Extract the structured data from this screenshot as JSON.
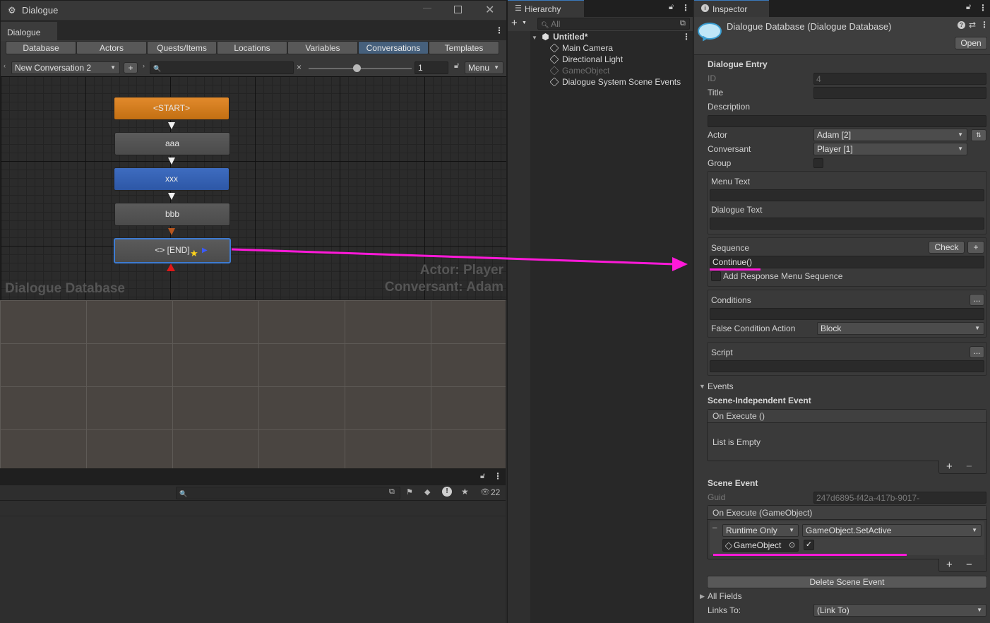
{
  "dialogue_window": {
    "title": "Dialogue",
    "tab": "Dialogue",
    "nav_tabs": [
      "Database",
      "Actors",
      "Quests/Items",
      "Locations",
      "Variables",
      "Conversations",
      "Templates"
    ],
    "active_tab": "Conversations",
    "conversation_select": "New Conversation 2",
    "add_label": "+",
    "clear_label": "×",
    "search_icon": "🔍",
    "zoom_value": "1",
    "menu_label": "Menu",
    "nodes": [
      {
        "label": "<START>",
        "type": "start"
      },
      {
        "label": "aaa",
        "type": "gray"
      },
      {
        "label": "xxx",
        "type": "blue"
      },
      {
        "label": "bbb",
        "type": "gray"
      },
      {
        "label": "<> [END]",
        "type": "selected"
      }
    ],
    "watermark_left": "Dialogue Database",
    "watermark_actor": "Actor: Player",
    "watermark_conversant": "Conversant: Adam",
    "project_count": "22"
  },
  "hierarchy": {
    "tab_label": "Hierarchy",
    "search_placeholder": "All",
    "scene_name": "Untitled*",
    "items": [
      {
        "label": "Main Camera",
        "dim": false
      },
      {
        "label": "Directional Light",
        "dim": false
      },
      {
        "label": "GameObject",
        "dim": true
      },
      {
        "label": "Dialogue System Scene Events",
        "dim": false
      }
    ]
  },
  "inspector": {
    "tab_label": "Inspector",
    "object_title": "Dialogue Database (Dialogue Database)",
    "open_button": "Open",
    "section_title": "Dialogue Entry",
    "fields": {
      "id_label": "ID",
      "id_value": "4",
      "title_label": "Title",
      "description_label": "Description",
      "actor_label": "Actor",
      "actor_value": "Adam [2]",
      "conversant_label": "Conversant",
      "conversant_value": "Player [1]",
      "group_label": "Group",
      "menu_text_label": "Menu Text",
      "dialogue_text_label": "Dialogue Text",
      "sequence_label": "Sequence",
      "check_button": "Check",
      "plus_button": "+",
      "sequence_value": "Continue()",
      "add_response_label": "Add Response Menu Sequence",
      "conditions_label": "Conditions",
      "ellipsis": "...",
      "false_action_label": "False Condition Action",
      "false_action_value": "Block",
      "script_label": "Script"
    },
    "events": {
      "title": "Events",
      "scene_independent_title": "Scene-Independent Event",
      "on_execute": "On Execute ()",
      "list_empty": "List is Empty",
      "scene_event_title": "Scene Event",
      "guid_label": "Guid",
      "guid_value": "247d6895-f42a-417b-9017-",
      "on_execute_go": "On Execute (GameObject)",
      "runtime_value": "Runtime Only",
      "function_value": "GameObject.SetActive",
      "object_value": "GameObject",
      "plus": "+",
      "minus": "−",
      "checkmark": "✓",
      "delete_button": "Delete Scene Event",
      "all_fields": "All Fields",
      "links_to_label": "Links To:",
      "links_to_value": "(Link To)"
    }
  },
  "colors": {
    "accent_magenta": "#ff19d9",
    "start_node": "#d47d1e",
    "blue_node": "#356ab8",
    "selected_border": "#3d7bd2",
    "active_tab": "#46607c"
  }
}
